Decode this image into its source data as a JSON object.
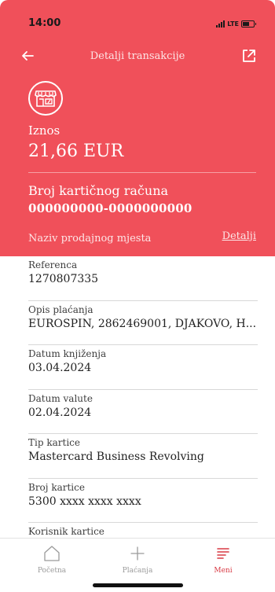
{
  "status_bar": {
    "time": "14:00",
    "network": "LTE"
  },
  "header": {
    "title": "Detalji transakcije",
    "amount_label": "Iznos",
    "amount": "21,66 EUR",
    "account_label": "Broj kartičnog računa",
    "account_number": "000000000-0000000000",
    "merchant_label": "Naziv prodajnog mjesta",
    "details_link": "Detalji"
  },
  "rows": [
    {
      "label": "Referenca",
      "value": "1270807335"
    },
    {
      "label": "Opis plaćanja",
      "value": "EUROSPIN, 2862469001, DJAKOVO, H..."
    },
    {
      "label": "Datum knjiženja",
      "value": "03.04.2024"
    },
    {
      "label": "Datum valute",
      "value": "02.04.2024"
    },
    {
      "label": "Tip kartice",
      "value": "Mastercard Business Revolving"
    },
    {
      "label": "Broj kartice",
      "value": "5300 xxxx xxxx xxxx"
    },
    {
      "label": "Korisnik kartice",
      "value": ""
    }
  ],
  "tabbar": {
    "tabs": [
      {
        "label": "Početna",
        "icon": "home-icon"
      },
      {
        "label": "Plaćanja",
        "icon": "plus-icon"
      },
      {
        "label": "Meni",
        "icon": "menu-icon"
      }
    ],
    "active_tab": "Meni"
  },
  "colors": {
    "header_background": "#f0505a",
    "active_tab": "#d83a44",
    "inactive_tab": "#9a9a9a"
  }
}
